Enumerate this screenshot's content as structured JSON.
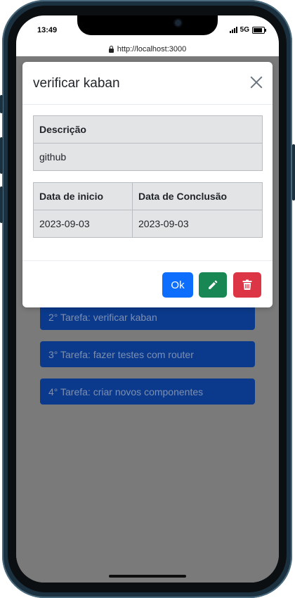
{
  "status_bar": {
    "time": "13:49",
    "network": "5G"
  },
  "browser": {
    "url": "http://localhost:3000"
  },
  "tasks": [
    {
      "label": "2° Tarefa: verificar kaban"
    },
    {
      "label": "3° Tarefa: fazer testes com router"
    },
    {
      "label": "4° Tarefa: criar novos componentes"
    }
  ],
  "modal": {
    "title": "verificar kaban",
    "description_header": "Descrição",
    "description_value": "github",
    "start_header": "Data de inicio",
    "end_header": "Data de Conclusão",
    "start_value": "2023-09-03",
    "end_value": "2023-09-03",
    "ok_label": "Ok",
    "edit_icon": "pencil-icon",
    "delete_icon": "trash-icon"
  },
  "colors": {
    "ok": "#0d6efd",
    "edit": "#198754",
    "delete": "#dc3545",
    "task_bg": "#0b3a8c",
    "backdrop": "#7a7a7a"
  }
}
